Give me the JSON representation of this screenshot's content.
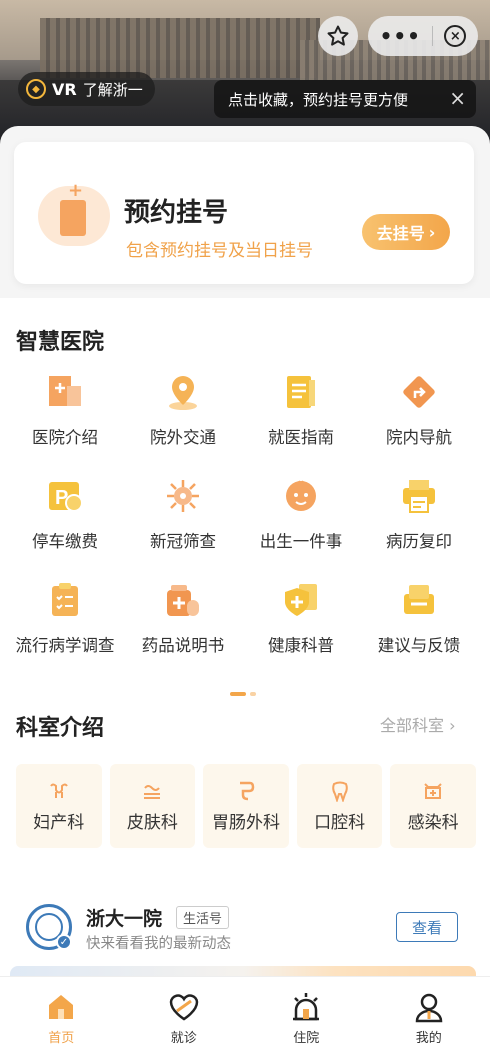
{
  "header": {
    "vr_label": "VR",
    "vr_text": "了解浙一",
    "tip_text": "点击收藏，预约挂号更方便",
    "more_label": "•••"
  },
  "appointment": {
    "title": "预约挂号",
    "subtitle": "包含预约挂号及当日挂号",
    "button": "去挂号"
  },
  "smart_hospital": {
    "title": "智慧医院",
    "items": [
      {
        "label": "医院介绍",
        "icon": "hospital-intro-icon"
      },
      {
        "label": "院外交通",
        "icon": "location-pin-icon"
      },
      {
        "label": "就医指南",
        "icon": "guide-book-icon"
      },
      {
        "label": "院内导航",
        "icon": "direction-sign-icon"
      },
      {
        "label": "停车缴费",
        "icon": "parking-icon"
      },
      {
        "label": "新冠筛查",
        "icon": "virus-icon"
      },
      {
        "label": "出生一件事",
        "icon": "baby-icon"
      },
      {
        "label": "病历复印",
        "icon": "printer-icon"
      },
      {
        "label": "流行病学调查",
        "icon": "clipboard-icon"
      },
      {
        "label": "药品说明书",
        "icon": "medicine-icon"
      },
      {
        "label": "健康科普",
        "icon": "health-shield-icon"
      },
      {
        "label": "建议与反馈",
        "icon": "feedback-icon"
      }
    ]
  },
  "departments": {
    "title": "科室介绍",
    "all_link": "全部科室 ›",
    "items": [
      {
        "label": "妇产科",
        "icon": "uterus-icon"
      },
      {
        "label": "皮肤科",
        "icon": "skin-icon"
      },
      {
        "label": "胃肠外科",
        "icon": "stomach-icon"
      },
      {
        "label": "口腔科",
        "icon": "tooth-icon"
      },
      {
        "label": "感染科",
        "icon": "infection-icon"
      }
    ]
  },
  "account": {
    "name": "浙大一院",
    "tag": "生活号",
    "desc": "快来看看我的最新动态",
    "button": "查看"
  },
  "tabbar": {
    "items": [
      {
        "label": "首页",
        "icon": "home-icon",
        "active": true
      },
      {
        "label": "就诊",
        "icon": "heart-pill-icon",
        "active": false
      },
      {
        "label": "住院",
        "icon": "alarm-light-icon",
        "active": false
      },
      {
        "label": "我的",
        "icon": "user-icon",
        "active": false
      }
    ]
  },
  "colors": {
    "accent": "#f3a64a",
    "accent_light": "#fde8d5",
    "link_blue": "#3d7ab8"
  }
}
